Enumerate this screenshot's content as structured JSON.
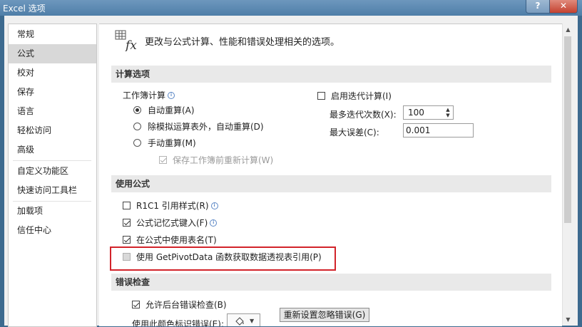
{
  "window": {
    "title": "Excel 选项",
    "help_label": "?",
    "close_label": "✕"
  },
  "sidebar": {
    "items": [
      {
        "label": "常规"
      },
      {
        "label": "公式"
      },
      {
        "label": "校对"
      },
      {
        "label": "保存"
      },
      {
        "label": "语言"
      },
      {
        "label": "轻松访问"
      },
      {
        "label": "高级"
      },
      {
        "label": "自定义功能区"
      },
      {
        "label": "快速访问工具栏"
      },
      {
        "label": "加载项"
      },
      {
        "label": "信任中心"
      }
    ],
    "active": "公式"
  },
  "header": {
    "text": "更改与公式计算、性能和错误处理相关的选项。"
  },
  "calc": {
    "title": "计算选项",
    "workbook_calc_label": "工作簿计算",
    "auto_label": "自动重算(A)",
    "auto_except_label": "除模拟运算表外，自动重算(D)",
    "manual_label": "手动重算(M)",
    "recalc_before_save_label": "保存工作簿前重新计算(W)",
    "iterative_label": "启用迭代计算(I)",
    "max_iter_label": "最多迭代次数(X):",
    "max_iter_value": "100",
    "max_change_label": "最大误差(C):",
    "max_change_value": "0.001"
  },
  "formulas": {
    "title": "使用公式",
    "r1c1_label": "R1C1 引用样式(R)",
    "autocomplete_label": "公式记忆式键入(F)",
    "table_names_label": "在公式中使用表名(T)",
    "getpivot_label": "使用 GetPivotData 函数获取数据透视表引用(P)"
  },
  "errors": {
    "title": "错误检查",
    "background_label": "允许后台错误检查(B)",
    "color_label": "使用此颜色标识错误(E):",
    "reset_button": "重新设置忽略错误(G)"
  },
  "icons": {
    "formula_options": "formula-fx-icon",
    "info": "info-icon",
    "paint_bucket": "paint-bucket-icon"
  },
  "colors": {
    "highlight_border": "#d2232a",
    "titlebar": "#4f7ea8",
    "active_nav": "#d8d8d8"
  }
}
